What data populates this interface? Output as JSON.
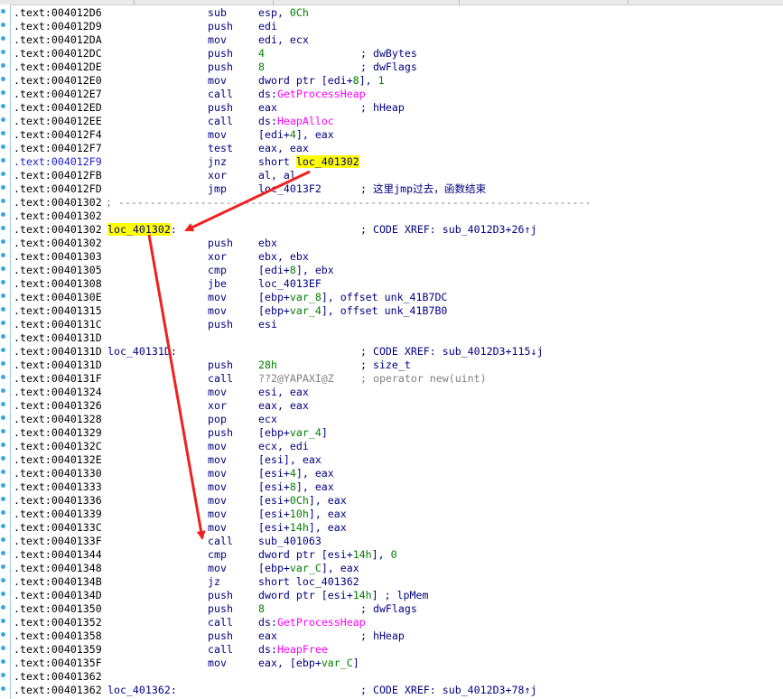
{
  "colors": {
    "code": "#000080",
    "number": "#008000",
    "api": "#ff00ff",
    "highlight": "#ffff00",
    "arrow": "#f02020"
  },
  "lines": [
    {
      "addr": ".text:004012D6",
      "mn": "sub",
      "op": [
        {
          "t": "esp, "
        },
        {
          "t": "0Ch",
          "c": "num"
        }
      ]
    },
    {
      "addr": ".text:004012D9",
      "mn": "push",
      "op": [
        {
          "t": "edi"
        }
      ]
    },
    {
      "addr": ".text:004012DA",
      "mn": "mov",
      "op": [
        {
          "t": "edi, ecx"
        }
      ]
    },
    {
      "addr": ".text:004012DC",
      "mn": "push",
      "op": [
        {
          "t": "4",
          "c": "num"
        }
      ],
      "cm": "; dwBytes"
    },
    {
      "addr": ".text:004012DE",
      "mn": "push",
      "op": [
        {
          "t": "8",
          "c": "num"
        }
      ],
      "cm": "; dwFlags"
    },
    {
      "addr": ".text:004012E0",
      "mn": "mov",
      "op": [
        {
          "t": "dword ptr [edi+"
        },
        {
          "t": "8",
          "c": "num"
        },
        {
          "t": "], "
        },
        {
          "t": "1",
          "c": "num"
        }
      ]
    },
    {
      "addr": ".text:004012E7",
      "mn": "call",
      "op": [
        {
          "t": "ds:"
        },
        {
          "t": "GetProcessHeap",
          "c": "api"
        }
      ]
    },
    {
      "addr": ".text:004012ED",
      "mn": "push",
      "op": [
        {
          "t": "eax"
        }
      ],
      "cm": "; hHeap"
    },
    {
      "addr": ".text:004012EE",
      "mn": "call",
      "op": [
        {
          "t": "ds:"
        },
        {
          "t": "HeapAlloc",
          "c": "api"
        }
      ]
    },
    {
      "addr": ".text:004012F4",
      "mn": "mov",
      "op": [
        {
          "t": "[edi+"
        },
        {
          "t": "4",
          "c": "num"
        },
        {
          "t": "], eax"
        }
      ]
    },
    {
      "addr": ".text:004012F7",
      "mn": "test",
      "op": [
        {
          "t": "eax, eax"
        }
      ]
    },
    {
      "addr": ".text:004012F9",
      "cur": true,
      "mn": "jnz",
      "op": [
        {
          "t": "short "
        },
        {
          "t": "loc_401302",
          "c": "hl"
        }
      ]
    },
    {
      "addr": ".text:004012FB",
      "mn": "xor",
      "op": [
        {
          "t": "al, al"
        }
      ]
    },
    {
      "addr": ".text:004012FD",
      "mn": "jmp",
      "op": [
        {
          "t": "loc_4013F2"
        }
      ],
      "cm": "; 这里jmp过去，函数结束"
    },
    {
      "addr": ".text:00401302",
      "dash": "; ---------------------------------------------------------------------------"
    },
    {
      "addr": ".text:00401302"
    },
    {
      "addr": ".text:00401302",
      "label": "loc_401302",
      "labelHl": true,
      "labelSuffix": ":",
      "cm": "; CODE XREF: sub_4012D3+26↑j"
    },
    {
      "addr": ".text:00401302",
      "mn": "push",
      "op": [
        {
          "t": "ebx"
        }
      ]
    },
    {
      "addr": ".text:00401303",
      "mn": "xor",
      "op": [
        {
          "t": "ebx, ebx"
        }
      ]
    },
    {
      "addr": ".text:00401305",
      "mn": "cmp",
      "op": [
        {
          "t": "[edi+"
        },
        {
          "t": "8",
          "c": "num"
        },
        {
          "t": "], ebx"
        }
      ]
    },
    {
      "addr": ".text:00401308",
      "mn": "jbe",
      "op": [
        {
          "t": "loc_4013EF"
        }
      ]
    },
    {
      "addr": ".text:0040130E",
      "mn": "mov",
      "op": [
        {
          "t": "[ebp+"
        },
        {
          "t": "var_8",
          "c": "var"
        },
        {
          "t": "], offset unk_41B7DC"
        }
      ]
    },
    {
      "addr": ".text:00401315",
      "mn": "mov",
      "op": [
        {
          "t": "[ebp+"
        },
        {
          "t": "var_4",
          "c": "var"
        },
        {
          "t": "], offset unk_41B7B0"
        }
      ]
    },
    {
      "addr": ".text:0040131C",
      "mn": "push",
      "op": [
        {
          "t": "esi"
        }
      ]
    },
    {
      "addr": ".text:0040131D"
    },
    {
      "addr": ".text:0040131D",
      "label": "loc_40131D",
      "labelSuffix": ":",
      "cm": "; CODE XREF: sub_4012D3+115↓j"
    },
    {
      "addr": ".text:0040131D",
      "mn": "push",
      "op": [
        {
          "t": "28h",
          "c": "num"
        }
      ],
      "cm": "; size_t"
    },
    {
      "addr": ".text:0040131F",
      "mn": "call",
      "op": [
        {
          "t": "??2@YAPAXI@Z",
          "c": "gray"
        }
      ],
      "cm": "; operator new(uint)",
      "cmGray": true
    },
    {
      "addr": ".text:00401324",
      "mn": "mov",
      "op": [
        {
          "t": "esi, eax"
        }
      ]
    },
    {
      "addr": ".text:00401326",
      "mn": "xor",
      "op": [
        {
          "t": "eax, eax"
        }
      ]
    },
    {
      "addr": ".text:00401328",
      "mn": "pop",
      "op": [
        {
          "t": "ecx"
        }
      ]
    },
    {
      "addr": ".text:00401329",
      "mn": "push",
      "op": [
        {
          "t": "[ebp+"
        },
        {
          "t": "var_4",
          "c": "var"
        },
        {
          "t": "]"
        }
      ]
    },
    {
      "addr": ".text:0040132C",
      "mn": "mov",
      "op": [
        {
          "t": "ecx, edi"
        }
      ]
    },
    {
      "addr": ".text:0040132E",
      "mn": "mov",
      "op": [
        {
          "t": "[esi], eax"
        }
      ]
    },
    {
      "addr": ".text:00401330",
      "mn": "mov",
      "op": [
        {
          "t": "[esi+"
        },
        {
          "t": "4",
          "c": "num"
        },
        {
          "t": "], eax"
        }
      ]
    },
    {
      "addr": ".text:00401333",
      "mn": "mov",
      "op": [
        {
          "t": "[esi+"
        },
        {
          "t": "8",
          "c": "num"
        },
        {
          "t": "], eax"
        }
      ]
    },
    {
      "addr": ".text:00401336",
      "mn": "mov",
      "op": [
        {
          "t": "[esi+"
        },
        {
          "t": "0Ch",
          "c": "num"
        },
        {
          "t": "], eax"
        }
      ]
    },
    {
      "addr": ".text:00401339",
      "mn": "mov",
      "op": [
        {
          "t": "[esi+"
        },
        {
          "t": "10h",
          "c": "num"
        },
        {
          "t": "], eax"
        }
      ]
    },
    {
      "addr": ".text:0040133C",
      "mn": "mov",
      "op": [
        {
          "t": "[esi+"
        },
        {
          "t": "14h",
          "c": "num"
        },
        {
          "t": "], eax"
        }
      ]
    },
    {
      "addr": ".text:0040133F",
      "mn": "call",
      "op": [
        {
          "t": "sub_401063"
        }
      ]
    },
    {
      "addr": ".text:00401344",
      "mn": "cmp",
      "op": [
        {
          "t": "dword ptr [esi+"
        },
        {
          "t": "14h",
          "c": "num"
        },
        {
          "t": "], "
        },
        {
          "t": "0",
          "c": "num"
        }
      ]
    },
    {
      "addr": ".text:00401348",
      "mn": "mov",
      "op": [
        {
          "t": "[ebp+"
        },
        {
          "t": "var_C",
          "c": "var"
        },
        {
          "t": "], eax"
        }
      ]
    },
    {
      "addr": ".text:0040134B",
      "mn": "jz",
      "op": [
        {
          "t": "short loc_401362"
        }
      ]
    },
    {
      "addr": ".text:0040134D",
      "mn": "push",
      "op": [
        {
          "t": "dword ptr [esi+"
        },
        {
          "t": "14h",
          "c": "num"
        },
        {
          "t": "] ; lpMem"
        }
      ]
    },
    {
      "addr": ".text:00401350",
      "mn": "push",
      "op": [
        {
          "t": "8",
          "c": "num"
        }
      ],
      "cm": "; dwFlags"
    },
    {
      "addr": ".text:00401352",
      "mn": "call",
      "op": [
        {
          "t": "ds:"
        },
        {
          "t": "GetProcessHeap",
          "c": "api"
        }
      ]
    },
    {
      "addr": ".text:00401358",
      "mn": "push",
      "op": [
        {
          "t": "eax"
        }
      ],
      "cm": "; hHeap"
    },
    {
      "addr": ".text:00401359",
      "mn": "call",
      "op": [
        {
          "t": "ds:"
        },
        {
          "t": "HeapFree",
          "c": "api"
        }
      ]
    },
    {
      "addr": ".text:0040135F",
      "mn": "mov",
      "op": [
        {
          "t": "eax, [ebp+"
        },
        {
          "t": "var_C",
          "c": "var"
        },
        {
          "t": "]"
        }
      ]
    },
    {
      "addr": ".text:00401362"
    },
    {
      "addr": ".text:00401362",
      "label": "loc_401362",
      "labelSuffix": ":",
      "cm": "; CODE XREF: sub_4012D3+78↑j"
    }
  ]
}
